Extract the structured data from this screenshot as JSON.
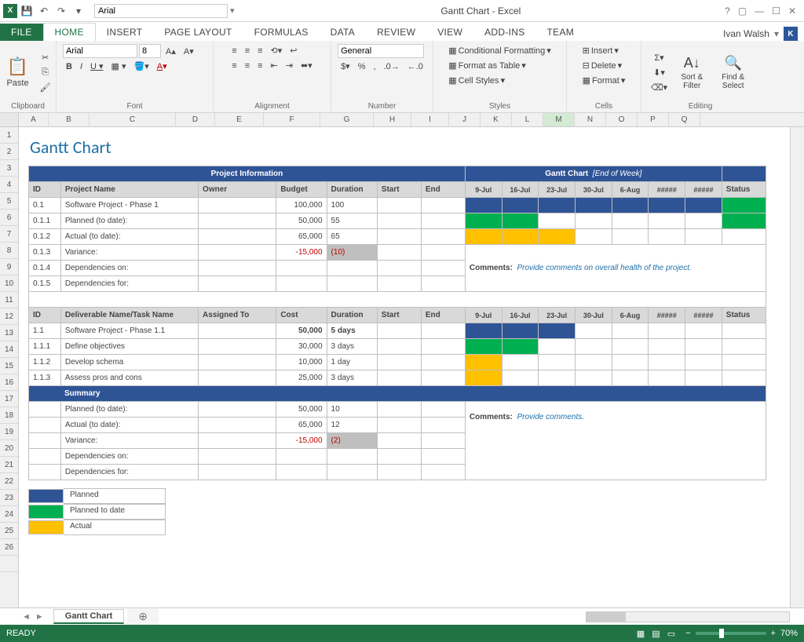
{
  "app": {
    "title": "Gantt Chart - Excel",
    "user": "Ivan Walsh",
    "ready": "READY",
    "zoom": "70%"
  },
  "qat": {
    "font": "Arial"
  },
  "tabs": [
    "FILE",
    "HOME",
    "INSERT",
    "PAGE LAYOUT",
    "FORMULAS",
    "DATA",
    "REVIEW",
    "VIEW",
    "ADD-INS",
    "TEAM"
  ],
  "ribbon": {
    "clipboard": {
      "label": "Clipboard",
      "paste": "Paste"
    },
    "font": {
      "label": "Font",
      "name": "Arial",
      "size": "8"
    },
    "alignment": {
      "label": "Alignment"
    },
    "number": {
      "label": "Number",
      "format": "General"
    },
    "styles": {
      "label": "Styles",
      "cond": "Conditional Formatting",
      "table": "Format as Table",
      "cell": "Cell Styles"
    },
    "cells": {
      "label": "Cells",
      "insert": "Insert",
      "delete": "Delete",
      "format": "Format"
    },
    "editing": {
      "label": "Editing",
      "sort": "Sort & Filter",
      "find": "Find & Select"
    }
  },
  "cols": [
    "A",
    "B",
    "C",
    "D",
    "E",
    "F",
    "G",
    "H",
    "I",
    "J",
    "K",
    "L",
    "M",
    "N",
    "O",
    "P",
    "Q"
  ],
  "rows": [
    "1",
    "2",
    "3",
    "4",
    "5",
    "6",
    "7",
    "8",
    "9",
    "10",
    "11",
    "12",
    "13",
    "14",
    "15",
    "16",
    "17",
    "18",
    "19",
    "20",
    "21",
    "22",
    "23",
    "24",
    "25",
    "26",
    ""
  ],
  "sheet": {
    "title": "Gantt Chart",
    "section1": "Project Information",
    "section2_a": "Gantt Chart",
    "section2_b": "[End of Week]",
    "headers1": {
      "id": "ID",
      "name": "Project Name",
      "owner": "Owner",
      "budget": "Budget",
      "duration": "Duration",
      "start": "Start",
      "end": "End",
      "status": "Status"
    },
    "dates": [
      "9-Jul",
      "16-Jul",
      "23-Jul",
      "30-Jul",
      "6-Aug",
      "#####",
      "#####"
    ],
    "rows1": [
      {
        "id": "0.1",
        "name": "Software Project - Phase 1",
        "budget": "100,000",
        "dur": "100",
        "gantt": [
          "b",
          "b",
          "b",
          "b",
          "b",
          "b",
          "b"
        ],
        "status": "g"
      },
      {
        "id": "0.1.1",
        "name": "Planned (to date):",
        "budget": "50,000",
        "dur": "55",
        "gantt": [
          "g",
          "g",
          "",
          "",
          "",
          "",
          ""
        ],
        "status": "g"
      },
      {
        "id": "0.1.2",
        "name": "Actual (to date):",
        "budget": "65,000",
        "dur": "65",
        "gantt": [
          "y",
          "y",
          "y",
          "",
          "",
          "",
          ""
        ],
        "status": ""
      },
      {
        "id": "0.1.3",
        "name": "Variance:",
        "budget": "-15,000",
        "dur": "(10)",
        "neg": true,
        "grey": true
      },
      {
        "id": "0.1.4",
        "name": "Dependencies on:"
      },
      {
        "id": "0.1.5",
        "name": "Dependencies for:"
      }
    ],
    "comments1_label": "Comments:",
    "comments1": "Provide comments on overall health of the project.",
    "headers2": {
      "id": "ID",
      "name": "Deliverable Name/Task Name",
      "owner": "Assigned To",
      "budget": "Cost",
      "duration": "Duration",
      "start": "Start",
      "end": "End",
      "status": "Status"
    },
    "rows2": [
      {
        "id": "1.1",
        "name": "Software Project - Phase 1.1",
        "budget": "50,000",
        "dur": "5 days",
        "bold": true,
        "gantt": [
          "b",
          "b",
          "b",
          "",
          "",
          "",
          ""
        ]
      },
      {
        "id": "1.1.1",
        "name": "Define objectives",
        "budget": "30,000",
        "dur": "3 days",
        "gantt": [
          "g",
          "g",
          "",
          "",
          "",
          "",
          ""
        ]
      },
      {
        "id": "1.1.2",
        "name": "Develop schema",
        "budget": "10,000",
        "dur": "1 day",
        "gantt": [
          "y",
          "",
          "",
          "",
          "",
          "",
          ""
        ]
      },
      {
        "id": "1.1.3",
        "name": "Assess pros and cons",
        "budget": "25,000",
        "dur": "3 days",
        "gantt": [
          "y",
          "",
          "",
          "",
          "",
          "",
          ""
        ]
      }
    ],
    "summary_label": "Summary",
    "rows3": [
      {
        "name": "Planned (to date):",
        "budget": "50,000",
        "dur": "10"
      },
      {
        "name": "Actual (to date):",
        "budget": "65,000",
        "dur": "12"
      },
      {
        "name": "Variance:",
        "budget": "-15,000",
        "dur": "(2)",
        "neg": true,
        "grey": true
      },
      {
        "name": "Dependencies on:"
      },
      {
        "name": "Dependencies for:"
      }
    ],
    "comments2_label": "Comments:",
    "comments2": "Provide comments.",
    "legend": [
      {
        "color": "#2f5496",
        "label": "Planned"
      },
      {
        "color": "#00b050",
        "label": "Planned to date"
      },
      {
        "color": "#ffc000",
        "label": "Actual"
      }
    ]
  },
  "tabbar": {
    "active": "Gantt Chart"
  }
}
